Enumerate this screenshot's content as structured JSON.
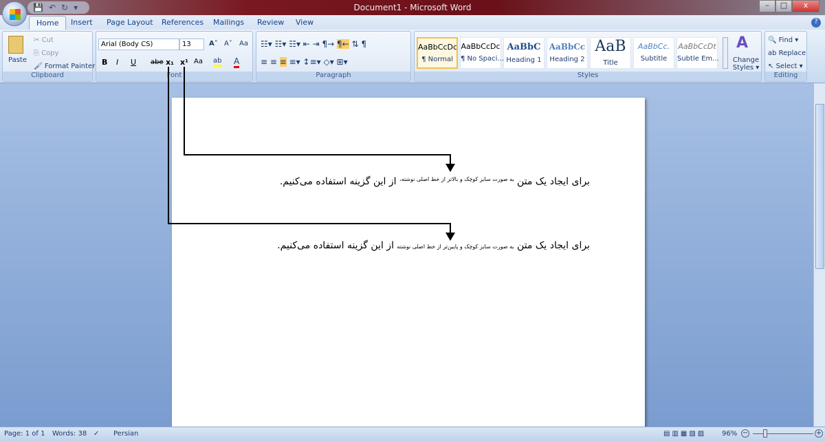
{
  "window": {
    "title": "Document1 - Microsoft Word",
    "minimize": "–",
    "maximize": "□",
    "close": "x"
  },
  "qat": {
    "save": "💾",
    "undo": "↶",
    "redo": "↻",
    "more": "▾"
  },
  "tabs": [
    "Home",
    "Insert",
    "Page Layout",
    "References",
    "Mailings",
    "Review",
    "View"
  ],
  "clipboard": {
    "label": "Clipboard",
    "paste": "Paste",
    "cut": "Cut",
    "copy": "Copy",
    "format_painter": "Format Painter"
  },
  "font": {
    "label": "Font",
    "font_name": "Arial (Body CS)",
    "font_size": "13",
    "grow": "A˄",
    "shrink": "A˅",
    "clear": "Aa",
    "bold": "B",
    "italic": "I",
    "underline": "U",
    "strike": "abe",
    "subscript": "x₁",
    "superscript": "x¹",
    "case": "Aa",
    "highlight": "ab",
    "color": "A"
  },
  "paragraph": {
    "label": "Paragraph"
  },
  "styles": {
    "label": "Styles",
    "items": [
      {
        "preview": "AaBbCcDc",
        "name": "¶ Normal"
      },
      {
        "preview": "AaBbCcDc",
        "name": "¶ No Spaci..."
      },
      {
        "preview": "AaBbC",
        "name": "Heading 1"
      },
      {
        "preview": "AaBbCc",
        "name": "Heading 2"
      },
      {
        "preview": "AaB",
        "name": "Title"
      },
      {
        "preview": "AaBbCc.",
        "name": "Subtitle"
      },
      {
        "preview": "AaBbCcDt",
        "name": "Subtle Em..."
      }
    ],
    "change_styles": "Change Styles ▾"
  },
  "editing": {
    "label": "Editing",
    "find": "Find ▾",
    "replace": "Replace",
    "select": "Select ▾"
  },
  "document": {
    "line1": {
      "start": "برای ایجاد یک متن ",
      "small": "به صورت سایز کوچک و بالاتر از خط اصلی نوشته،",
      "end": " از این گزینه استفاده می‌کنیم."
    },
    "line2": {
      "start": "برای ایجاد یک متن ",
      "small": "به صورت سایز کوچک و پایین‌تر از خط اصلی نوشته",
      "end": " از این گزینه استفاده می‌کنیم."
    }
  },
  "status": {
    "page": "Page: 1 of 1",
    "words": "Words: 38",
    "language": "Persian",
    "zoom": "96%",
    "zoom_level_percent": 96
  }
}
